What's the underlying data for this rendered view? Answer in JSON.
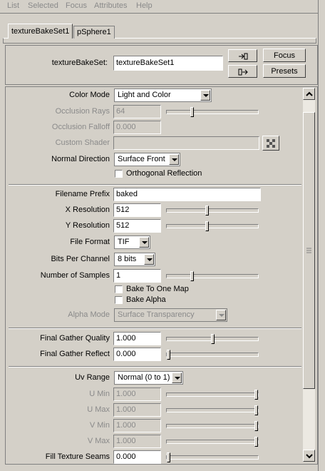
{
  "menu": [
    "List",
    "Selected",
    "Focus",
    "Attributes",
    "Help"
  ],
  "tabs": [
    "textureBakeSet1",
    "pSphere1"
  ],
  "node": {
    "label": "textureBakeSet:",
    "value": "textureBakeSet1",
    "focus": "Focus",
    "presets": "Presets"
  },
  "attrs": {
    "color_mode": {
      "label": "Color Mode",
      "value": "Light and Color"
    },
    "occlusion_rays": {
      "label": "Occlusion Rays",
      "value": "64"
    },
    "occlusion_falloff": {
      "label": "Occlusion Falloff",
      "value": "0.000"
    },
    "custom_shader": {
      "label": "Custom Shader",
      "value": ""
    },
    "normal_direction": {
      "label": "Normal Direction",
      "value": "Surface Front"
    },
    "orthogonal_reflection": "Orthogonal Reflection",
    "filename_prefix": {
      "label": "Filename Prefix",
      "value": "baked"
    },
    "x_resolution": {
      "label": "X Resolution",
      "value": "512"
    },
    "y_resolution": {
      "label": "Y Resolution",
      "value": "512"
    },
    "file_format": {
      "label": "File Format",
      "value": "TIF"
    },
    "bits_per_channel": {
      "label": "Bits Per Channel",
      "value": "8 bits"
    },
    "number_of_samples": {
      "label": "Number of Samples",
      "value": "1"
    },
    "bake_to_one_map": "Bake To One Map",
    "bake_alpha": "Bake Alpha",
    "alpha_mode": {
      "label": "Alpha Mode",
      "value": "Surface Transparency"
    },
    "fg_quality": {
      "label": "Final Gather Quality",
      "value": "1.000"
    },
    "fg_reflect": {
      "label": "Final Gather Reflect",
      "value": "0.000"
    },
    "uv_range": {
      "label": "Uv Range",
      "value": "Normal (0 to 1)"
    },
    "u_min": {
      "label": "U Min",
      "value": "1.000"
    },
    "u_max": {
      "label": "U Max",
      "value": "1.000"
    },
    "v_min": {
      "label": "V Min",
      "value": "1.000"
    },
    "v_max": {
      "label": "V Max",
      "value": "1.000"
    },
    "fill_texture_seams": {
      "label": "Fill Texture Seams",
      "value": "0.000"
    }
  },
  "sliders": {
    "occlusion_rays": 0.27,
    "x_resolution": 0.44,
    "y_resolution": 0.44,
    "number_of_samples": 0.27,
    "fg_quality": 0.5,
    "fg_reflect": 0.0,
    "u_min": 1.0,
    "u_max": 1.0,
    "v_min": 1.0,
    "v_max": 1.0,
    "fill_texture_seams": 0.0
  },
  "icons": {
    "input_conn": "input-connection-icon",
    "output_conn": "output-connection-icon",
    "shader_browse": "shader-browse-icon"
  }
}
